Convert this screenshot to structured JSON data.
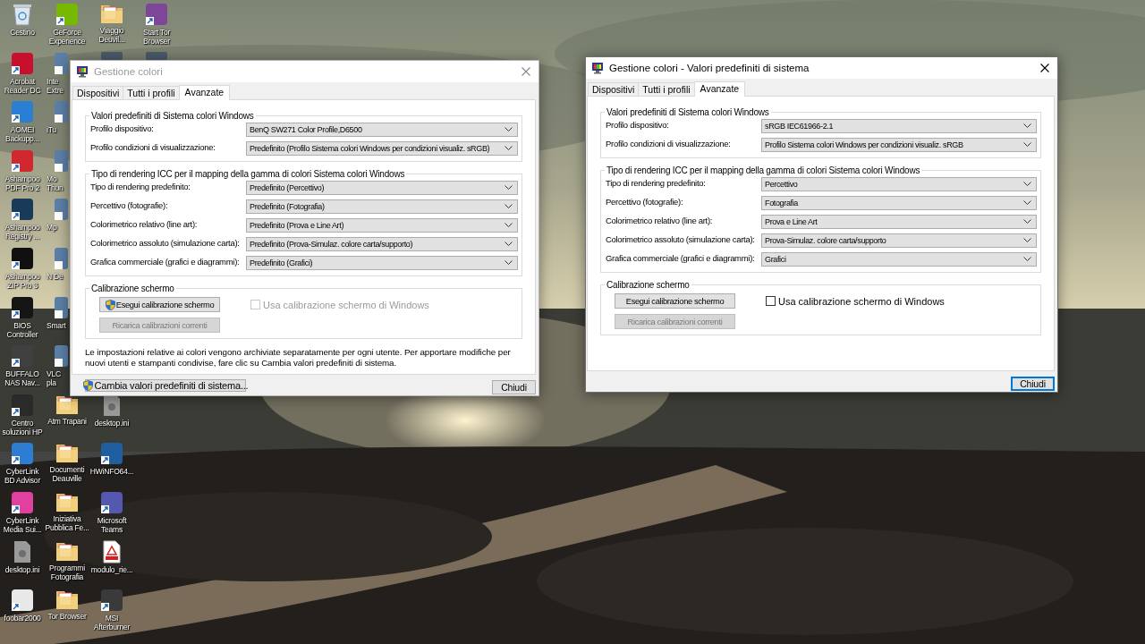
{
  "desktop": {
    "icon_columns": [
      [
        {
          "kind": "bin",
          "label": "Cestino"
        },
        {
          "kind": "app",
          "label": "Acrobat Reader DC",
          "color": "#c8102e"
        },
        {
          "kind": "app",
          "label": "AOMEI Backupp...",
          "color": "#2a7fd4"
        },
        {
          "kind": "app",
          "label": "Ashampoo PDF Pro 2",
          "color": "#d0282e"
        },
        {
          "kind": "app",
          "label": "Ashampoo Registry ...",
          "color": "#1a3a5a"
        },
        {
          "kind": "app",
          "label": "Ashampoo ZIP Pro 3",
          "color": "#101010"
        },
        {
          "kind": "app",
          "label": "BIOS Controller",
          "color": "#151515"
        },
        {
          "kind": "app",
          "label": "BUFFALO NAS Nav...",
          "color": "#404040"
        },
        {
          "kind": "app",
          "label": "Centro soluzioni HP",
          "color": "#2a2a2a"
        },
        {
          "kind": "app",
          "label": "CyberLink BD Advisor",
          "color": "#2d7dd2"
        },
        {
          "kind": "app",
          "label": "CyberLink Media Sui...",
          "color": "#e040a0"
        },
        {
          "kind": "file",
          "label": "desktop.ini"
        },
        {
          "kind": "app",
          "label": "foobar2000",
          "color": "#e8e8e8"
        }
      ],
      [
        {
          "kind": "app",
          "label": "GeForce Experience",
          "color": "#76b900"
        },
        {
          "kind": "covered",
          "label": "Inte Extre"
        },
        {
          "kind": "covered",
          "label": "iTu"
        },
        {
          "kind": "covered",
          "label": "Mo Thun"
        },
        {
          "kind": "covered",
          "label": "Mp"
        },
        {
          "kind": "covered",
          "label": "N De"
        },
        {
          "kind": "covered",
          "label": "Smart"
        },
        {
          "kind": "covered",
          "label": "VLC pla"
        },
        {
          "kind": "folder",
          "label": "Atm Trapani"
        },
        {
          "kind": "folder",
          "label": "Documenti Deauville"
        },
        {
          "kind": "folder",
          "label": "Iniziativa Pubblica Fe..."
        },
        {
          "kind": "folder",
          "label": "Programmi Fotografia"
        },
        {
          "kind": "folder",
          "label": "Tor Browser"
        }
      ],
      [
        {
          "kind": "folder",
          "label": "Viaggio Deuvil..."
        },
        {
          "kind": "peek"
        },
        {
          "kind": "blank"
        },
        {
          "kind": "blank"
        },
        {
          "kind": "blank"
        },
        {
          "kind": "blank"
        },
        {
          "kind": "blank"
        },
        {
          "kind": "blank"
        },
        {
          "kind": "file",
          "label": "desktop.ini"
        },
        {
          "kind": "app",
          "label": "HWiNFO64...",
          "color": "#1f5fa0"
        },
        {
          "kind": "app",
          "label": "Microsoft Teams",
          "color": "#5558af"
        },
        {
          "kind": "pdf",
          "label": "modulo_rie..."
        },
        {
          "kind": "app",
          "label": "MSI Afterburner",
          "color": "#3a3a3a"
        }
      ],
      [
        {
          "kind": "app",
          "label": "Start Tor Browser",
          "color": "#7d4698"
        },
        {
          "kind": "peek"
        }
      ]
    ]
  },
  "windows": [
    {
      "title": "Gestione colori",
      "active": false,
      "tabs": [
        {
          "label": "Dispositivi",
          "selected": false
        },
        {
          "label": "Tutti i profili",
          "selected": false
        },
        {
          "label": "Avanzate",
          "selected": true
        }
      ],
      "groups": [
        {
          "kind": "dropdowns",
          "title": "Valori predefiniti di Sistema colori Windows",
          "rows": [
            {
              "label": "Profilo dispositivo:",
              "value": "BenQ SW271 Color Profile,D6500"
            },
            {
              "label": "Profilo condizioni di visualizzazione:",
              "value": "Predefinito (Profilo Sistema colori Windows per condizioni visualiz. sRGB)"
            }
          ]
        },
        {
          "kind": "dropdowns",
          "title": "Tipo di rendering ICC per il mapping della gamma di colori Sistema colori Windows",
          "rows": [
            {
              "label": "Tipo di rendering predefinito:",
              "value": "Predefinito (Percettivo)"
            },
            {
              "label": "Percettivo (fotografie):",
              "value": "Predefinito (Fotografia)"
            },
            {
              "label": "Colorimetrico relativo (line art):",
              "value": "Predefinito (Prova e Line Art)"
            },
            {
              "label": "Colorimetrico assoluto (simulazione carta):",
              "value": "Predefinito (Prova-Simulaz. colore carta/supporto)"
            },
            {
              "label": "Grafica commerciale (grafici e diagrammi):",
              "value": "Predefinito (Grafici)"
            }
          ]
        },
        {
          "kind": "calibration",
          "title": "Calibrazione schermo",
          "buttons": [
            {
              "label": "Esegui calibrazione schermo",
              "shield": true,
              "disabled": false
            },
            {
              "label": "Ricarica calibrazioni correnti",
              "shield": false,
              "disabled": true
            }
          ],
          "checkbox": {
            "label": "Usa calibrazione schermo di Windows",
            "checked": false,
            "disabled": true
          }
        }
      ],
      "note": "Le impostazioni relative ai colori vengono archiviate separatamente per ogni utente. Per apportare modifiche per nuovi utenti e stampanti condivise, fare clic su Cambia valori predefiniti di sistema.",
      "system_button": {
        "label": "Cambia valori predefiniti di sistema...",
        "shield": true
      },
      "close_button": {
        "label": "Chiudi",
        "focused": false
      }
    },
    {
      "title": "Gestione colori - Valori predefiniti di sistema",
      "active": true,
      "tabs": [
        {
          "label": "Dispositivi",
          "selected": false
        },
        {
          "label": "Tutti i profili",
          "selected": false
        },
        {
          "label": "Avanzate",
          "selected": true
        }
      ],
      "groups": [
        {
          "kind": "dropdowns",
          "title": "Valori predefiniti di Sistema colori Windows",
          "rows": [
            {
              "label": "Profilo dispositivo:",
              "value": "sRGB IEC61966-2.1"
            },
            {
              "label": "Profilo condizioni di visualizzazione:",
              "value": "Profilo Sistema colori Windows per condizioni visualiz. sRGB"
            }
          ]
        },
        {
          "kind": "dropdowns",
          "title": "Tipo di rendering ICC per il mapping della gamma di colori Sistema colori Windows",
          "rows": [
            {
              "label": "Tipo di rendering predefinito:",
              "value": "Percettivo"
            },
            {
              "label": "Percettivo (fotografie):",
              "value": "Fotografia"
            },
            {
              "label": "Colorimetrico relativo (line art):",
              "value": "Prova e Line Art"
            },
            {
              "label": "Colorimetrico assoluto (simulazione carta):",
              "value": "Prova-Simulaz. colore carta/supporto"
            },
            {
              "label": "Grafica commerciale (grafici e diagrammi):",
              "value": "Grafici"
            }
          ]
        },
        {
          "kind": "calibration",
          "title": "Calibrazione schermo",
          "buttons": [
            {
              "label": "Esegui calibrazione schermo",
              "shield": false,
              "disabled": false
            },
            {
              "label": "Ricarica calibrazioni correnti",
              "shield": false,
              "disabled": true
            }
          ],
          "checkbox": {
            "label": "Usa calibrazione schermo di Windows",
            "checked": false,
            "disabled": false
          }
        }
      ],
      "close_button": {
        "label": "Chiudi",
        "focused": true
      }
    }
  ]
}
